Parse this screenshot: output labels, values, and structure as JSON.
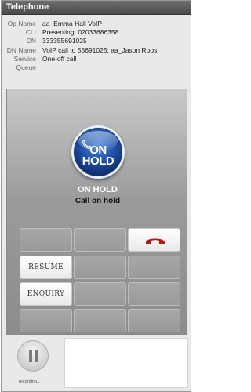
{
  "window": {
    "title": "Telephone"
  },
  "call_info": [
    {
      "label": "Op Name",
      "value": "aa_Emma Hall VoIP"
    },
    {
      "label": "CLI",
      "value": "Presenting: 02033686358"
    },
    {
      "label": "DN",
      "value": "333355691025"
    },
    {
      "label": "DN Name",
      "value": "VoIP call to 55691025: aa_Jason Roos"
    },
    {
      "label": "Service",
      "value": "One-off call"
    },
    {
      "label": "Queue",
      "value": ""
    }
  ],
  "hold": {
    "button_text": "ON HOLD",
    "state_title": "ON HOLD",
    "state_subtitle": "Call on hold"
  },
  "buttons": {
    "resume": "RESUME",
    "enquiry": "ENQUIRY"
  },
  "recording": {
    "label": "recording..."
  },
  "colors": {
    "hold_blue": "#1f4fa5",
    "hangup_red": "#b01a1a"
  }
}
